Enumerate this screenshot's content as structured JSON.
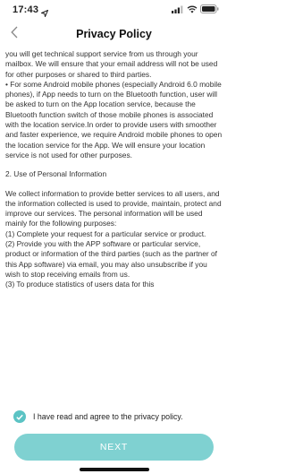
{
  "status_bar": {
    "time": "17:43",
    "icons": [
      "location-arrow-icon",
      "cellular-signal-icon",
      "wifi-icon",
      "battery-icon"
    ]
  },
  "nav": {
    "title": "Privacy Policy",
    "back_icon": "chevron-left-icon"
  },
  "content": {
    "paragraphs": [
      "you will get technical support service from us through your mailbox. We will ensure that your email address will not be used for other purposes or shared to third parties.",
      "• For some Android mobile phones (especially Android 6.0 mobile phones), if App needs to turn on the Bluetooth function, user will be asked to turn on the App location service, because the Bluetooth function switch of those mobile phones is associated with the location service.In order to provide users with smoother and faster experience, we require Android mobile phones to open the location service for the App. We will ensure your location service is not used for other purposes.",
      "2. Use of Personal Information",
      "We collect information to provide better services to all users, and the information collected is used to provide, maintain, protect and improve our services. The personal information will be used mainly for the following purposes:",
      "(1) Complete your request for a particular service or product.",
      "(2) Provide you with the APP software or particular service, product or information of the third parties (such as the partner of this App software) via email, you may also unsubscribe if you wish to stop receiving emails from us.",
      "(3) To produce statistics of users data for this"
    ]
  },
  "agreement": {
    "label": "I have read and agree to the privacy policy.",
    "checked": true,
    "check_icon": "checkmark-icon"
  },
  "next_button": {
    "label": "NEXT"
  },
  "colors": {
    "accent": "#5bc3c4",
    "button": "#7fd1d1"
  }
}
